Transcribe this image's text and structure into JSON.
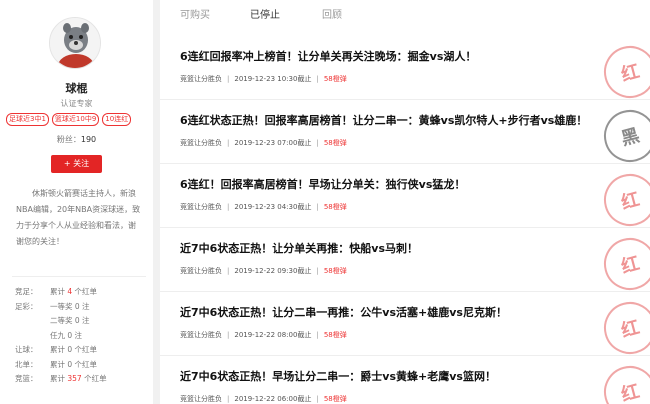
{
  "profile": {
    "name": "球棍",
    "cert": "认证专家",
    "tags": [
      "足球近3中1",
      "篮球近10中9",
      "10连红"
    ],
    "fans_label": "粉丝：",
    "fans_count": "190",
    "follow_label": "+ 关注",
    "bio": "休斯顿火箭赛话主持人，新浪NBA编辑，20年NBA资深球迷，致力于分享个人从业经验和看法，谢谢您的关注！"
  },
  "stats": [
    {
      "key": "竞足：",
      "pre": "累计 ",
      "num": "4",
      "post": " 个红单"
    },
    {
      "key": "足彩：",
      "pre": "一等奖 0 注",
      "num": "",
      "post": ""
    },
    {
      "key": "",
      "pre": "二等奖 0 注",
      "num": "",
      "post": ""
    },
    {
      "key": "",
      "pre": "任九 0 注",
      "num": "",
      "post": ""
    },
    {
      "key": "让球：",
      "pre": "累计 0 个红单",
      "num": "",
      "post": ""
    },
    {
      "key": "北单：",
      "pre": "累计 0 个红单",
      "num": "",
      "post": ""
    },
    {
      "key": "竞篮：",
      "pre": "累计 ",
      "num": "357",
      "post": " 个红单"
    }
  ],
  "tabs": [
    "可购买",
    "已停止",
    "回顾"
  ],
  "items": [
    {
      "title": "6连红回报率冲上榜首！让分单关再关注晚场：掘金vs湖人！",
      "type": "竞篮让分胜负",
      "time": "2019-12-23 10:30截止",
      "price": "58橙弹",
      "stamp": "红"
    },
    {
      "title": "6连红状态正热！回报率高居榜首！让分二串一：黄蜂vs凯尔特人+步行者vs雄鹿！",
      "type": "竞篮让分胜负",
      "time": "2019-12-23 07:00截止",
      "price": "58橙弹",
      "stamp": "黑"
    },
    {
      "title": "6连红！回报率高居榜首！早场让分单关：独行侠vs猛龙！",
      "type": "竞篮让分胜负",
      "time": "2019-12-23 04:30截止",
      "price": "58橙弹",
      "stamp": "红"
    },
    {
      "title": "近7中6状态正热！让分单关再推：快船vs马刺！",
      "type": "竞篮让分胜负",
      "time": "2019-12-22 09:30截止",
      "price": "58橙弹",
      "stamp": "红"
    },
    {
      "title": "近7中6状态正热！让分二串一再推：公牛vs活塞+雄鹿vs尼克斯！",
      "type": "竞篮让分胜负",
      "time": "2019-12-22 08:00截止",
      "price": "58橙弹",
      "stamp": "红"
    },
    {
      "title": "近7中6状态正热！早场让分二串一：爵士vs黄蜂+老鹰vs篮网！",
      "type": "竞篮让分胜负",
      "time": "2019-12-22 06:00截止",
      "price": "58橙弹",
      "stamp": "红"
    }
  ]
}
